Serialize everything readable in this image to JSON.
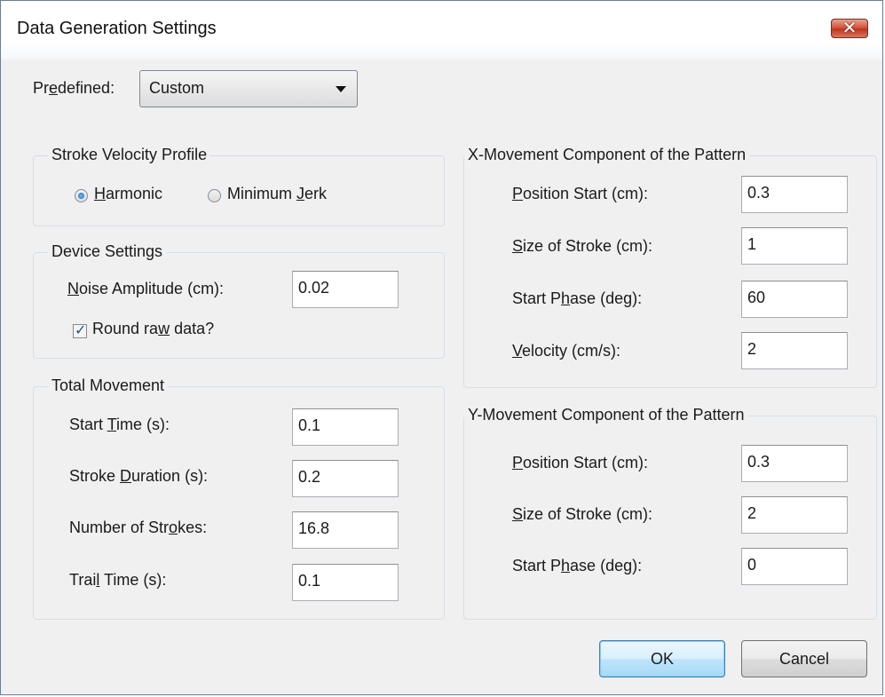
{
  "window": {
    "title": "Data Generation Settings",
    "close_glyph": "✕"
  },
  "predefined": {
    "label_pre": "Pr",
    "label_u": "e",
    "label_post": "defined:",
    "selected": "Custom"
  },
  "stroke_velocity": {
    "title": "Stroke Velocity Profile",
    "harmonic": {
      "u": "H",
      "rest": "armonic",
      "checked": true
    },
    "minimum_jerk": {
      "pre": "Minimum ",
      "u": "J",
      "post": "erk",
      "checked": false
    }
  },
  "device": {
    "title": "Device Settings",
    "noise_u": "N",
    "noise_rest": "oise Amplitude (cm):",
    "noise_value": "0.02",
    "round_pre": "Round ra",
    "round_u": "w",
    "round_post": " data?",
    "round_checked": true,
    "check_glyph": "✓"
  },
  "total": {
    "title": "Total Movement",
    "start_time": {
      "pre": "Start ",
      "u": "T",
      "post": "ime (s):",
      "value": "0.1"
    },
    "stroke_duration": {
      "pre": "Stroke ",
      "u": "D",
      "post": "uration (s):",
      "value": "0.2"
    },
    "num_strokes": {
      "pre": "Number of Str",
      "u": "o",
      "post": "kes:",
      "value": "16.8"
    },
    "trail_time": {
      "pre": "Trai",
      "u": "l",
      "post": " Time (s):",
      "value": "0.1"
    }
  },
  "x_move": {
    "title": "X-Movement Component of the Pattern",
    "position_start": {
      "pre": "",
      "u": "P",
      "post": "osition Start (cm):",
      "value": "0.3"
    },
    "size_stroke": {
      "pre": "",
      "u": "S",
      "post": "ize of Stroke (cm):",
      "value": "1"
    },
    "start_phase": {
      "pre": "Start P",
      "u": "h",
      "post": "ase (deg):",
      "value": "60"
    },
    "velocity": {
      "pre": "",
      "u": "V",
      "post": "elocity (cm/s):",
      "value": "2"
    }
  },
  "y_move": {
    "title": "Y-Movement Component of the Pattern",
    "position_start": {
      "pre": "",
      "u": "P",
      "post": "osition Start (cm):",
      "value": "0.3"
    },
    "size_stroke": {
      "pre": "",
      "u": "S",
      "post": "ize of Stroke (cm):",
      "value": "2"
    },
    "start_phase": {
      "pre": "Start P",
      "u": "h",
      "post": "ase (deg):",
      "value": "0"
    }
  },
  "buttons": {
    "ok": "OK",
    "cancel": "Cancel"
  }
}
